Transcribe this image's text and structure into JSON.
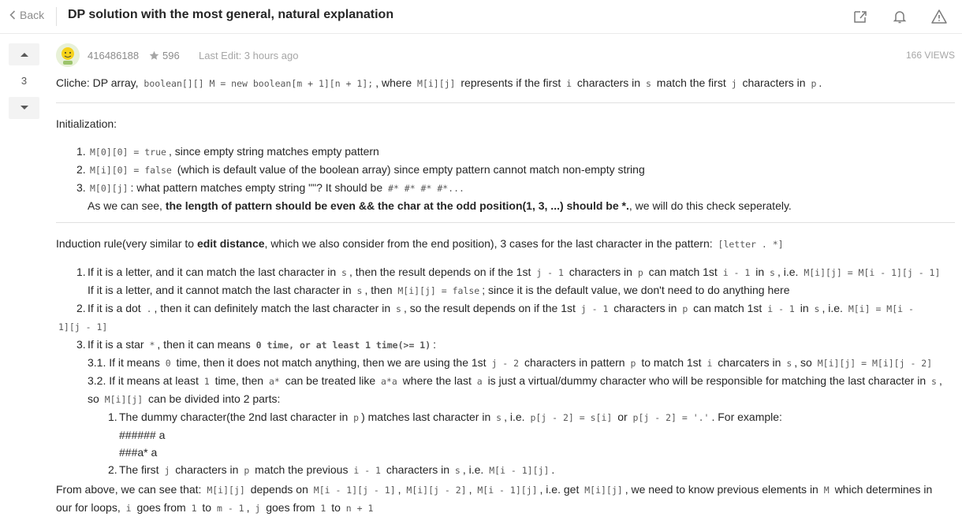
{
  "topbar": {
    "back_label": "Back",
    "title": "DP solution with the most general, natural explanation"
  },
  "votes": {
    "count": "3"
  },
  "meta": {
    "username": "416486188",
    "reputation": "596",
    "last_edit": "Last Edit: 3 hours ago",
    "views": "166 VIEWS"
  },
  "post": {
    "intro": {
      "t1": "Cliche: DP array,",
      "c1": "boolean[][] M = new boolean[m + 1][n + 1];",
      "t2": ", where",
      "c2": "M[i][j]",
      "t3": "represents if the first",
      "c3": "i",
      "t4": "characters in",
      "c4": "s",
      "t5": "match the first",
      "c5": "j",
      "t6": "characters in",
      "c6": "p",
      "t7": "."
    },
    "init": {
      "heading": "Initialization:",
      "i1": {
        "num": "1.",
        "c1": "M[0][0] = true",
        "t1": ", since empty string matches empty pattern"
      },
      "i2": {
        "num": "2.",
        "c1": "M[i][0] = false",
        "t1": "(which is default value of the boolean array) since empty pattern cannot match non-empty string"
      },
      "i3": {
        "num": "3.",
        "c1": "M[0][j]",
        "t1": ": what pattern matches empty string \"\"? It should be",
        "c2": "#* #* #* #*...",
        "t2": "As we can see,",
        "b1": "the length of pattern should be even && the char at the odd position(1, 3, ...) should be *.",
        "t3": ", we will do this check seperately."
      }
    },
    "induction": {
      "t1": "Induction rule(very similar to",
      "b1": "edit distance",
      "t2": ", which we also consider from the end position), 3 cases for the last character in the pattern:",
      "c1": "[letter . *]",
      "case1": {
        "num": "1.",
        "a1": "If it is a letter, and it can match the last character in",
        "ac1": "s",
        "a2": ", then the result depends on if the 1st",
        "ac2": "j - 1",
        "a3": "characters in",
        "ac3": "p",
        "a4": "can match 1st",
        "ac4": "i - 1",
        "a5": "in",
        "ac5": "s",
        "a6": ", i.e.",
        "ac6": "M[i][j] = M[i - 1][j - 1]",
        "b1": "If it is a letter, and it cannot match the last character in",
        "bc1": "s",
        "b2": ", then",
        "bc2": "M[i][j] = false",
        "b3": "; since it is the default value, we don't need to do anything here"
      },
      "case2": {
        "num": "2.",
        "a1": "If it is a dot",
        "ac1": ".",
        "a2": ", then it can definitely match the last character in",
        "ac2": "s",
        "a3": ", so the result depends on if the 1st",
        "ac3": "j - 1",
        "a4": "characters in",
        "ac4": "p",
        "a5": "can match 1st",
        "ac5": "i - 1",
        "a6": "in",
        "ac6": "s",
        "a7": ", i.e.",
        "ac7a": "M[i] = M[i -",
        "ac7b": "1][j - 1]"
      },
      "case3": {
        "num": "3.",
        "a1": "If it is a star",
        "ac1": "*",
        "a2": ", then it can means",
        "ac2": "0 time, or at least 1 time(>= 1)",
        "a3": ":",
        "s1": {
          "t1": "3.1. If it means",
          "c1": "0",
          "t2": "time, then it does not match anything, then we are using the 1st",
          "c2": "j - 2",
          "t3": "characters in pattern",
          "c3": "p",
          "t4": "to match 1st",
          "c4": "i",
          "t5": "charcaters in",
          "c5": "s",
          "t6": ", so",
          "c6": "M[i][j] = M[i][j - 2]"
        },
        "s2": {
          "t1": "3.2. If it means at least",
          "c1": "1",
          "t2": "time, then",
          "c2": "a*",
          "t3": "can be treated like",
          "c3": "a*a",
          "t4": "where the last",
          "c4": "a",
          "t5": "is just a virtual/dummy character who will be responsible for matching the last character in",
          "c5": "s",
          "t6": ",",
          "t7": "so",
          "c7": "M[i][j]",
          "t8": "can be divided into 2 parts:"
        },
        "p1": {
          "num": "1.",
          "t1": "The dummy character(the 2nd last character in",
          "c1": "p",
          "t2": ") matches last character in",
          "c2": "s",
          "t3": ", i.e.",
          "c3": "p[j - 2] = s[i]",
          "t4": "or",
          "c4": "p[j - 2] = '.'",
          "t5": ". For example:",
          "ex1": "###### a",
          "ex2": "###a* a"
        },
        "p2": {
          "num": "2.",
          "t1": "The first",
          "c1": "j",
          "t2": "characters in",
          "c2": "p",
          "t3": "match the previous",
          "c3": "i - 1",
          "t4": "characters in",
          "c4": "s",
          "t5": ", i.e.",
          "c5": "M[i - 1][j]",
          "t6": "."
        }
      }
    },
    "conclusion": {
      "t1": "From above, we can see that:",
      "c1": "M[i][j]",
      "t2": "depends on",
      "c2": "M[i - 1][j - 1]",
      "t3": ",",
      "c3": "M[i][j - 2]",
      "t4": ",",
      "c4": "M[i - 1][j]",
      "t5": ", i.e. get",
      "c5": "M[i][j]",
      "t6": ", we need to know previous elements in",
      "c6": "M",
      "t7": "which determines in",
      "t8": "our for loops,",
      "c8": "i",
      "t9": "goes from",
      "c9": "1",
      "t10": "to",
      "c10": "m - 1",
      "t11": ",",
      "c11": "j",
      "t12": "goes from",
      "c12": "1",
      "t13": "to",
      "c13": "n + 1"
    }
  }
}
